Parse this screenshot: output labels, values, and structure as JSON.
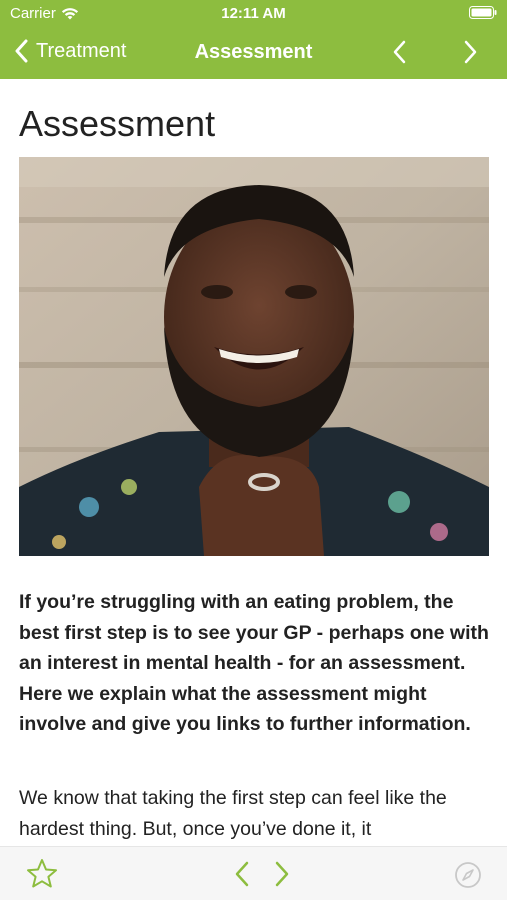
{
  "status_bar": {
    "carrier": "Carrier",
    "time": "12:11 AM"
  },
  "nav": {
    "back_label": "Treatment",
    "title": "Assessment"
  },
  "article": {
    "title": "Assessment",
    "lead": "If you’re struggling with an eating problem, the best first step is to see your GP - perhaps one with an interest in mental health - for an assessment. Here we explain what the assessment might involve and give you links to further information.",
    "body": "We know that taking the first step can feel like the hardest thing. But, once you’ve done it, it"
  },
  "colors": {
    "accent": "#8dbd3f",
    "toolbar_icon": "#8dbd3f",
    "text": "#222222"
  },
  "icons": [
    "wifi-icon",
    "battery-icon",
    "chevron-left-icon",
    "chevron-right-icon",
    "star-icon",
    "compass-icon"
  ]
}
